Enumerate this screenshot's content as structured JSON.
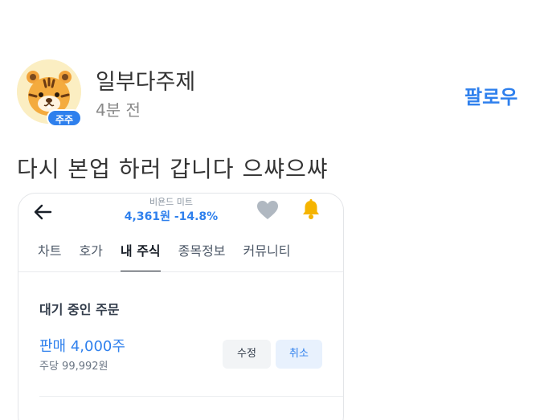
{
  "post": {
    "username": "일부다주제",
    "timestamp": "4분 전",
    "badge": "주주",
    "follow_label": "팔로우",
    "text": "다시 본업 하러 갑니다 으쌰으쌰"
  },
  "stock_app": {
    "stock_name": "비욘드 미트",
    "price_line": "4,361원 -14.8%",
    "tabs": [
      {
        "label": "차트",
        "active": false
      },
      {
        "label": "호가",
        "active": false
      },
      {
        "label": "내 주식",
        "active": true
      },
      {
        "label": "종목정보",
        "active": false
      },
      {
        "label": "커뮤니티",
        "active": false
      }
    ],
    "section_title": "대기 중인 주문",
    "order": {
      "title": "판매 4,000주",
      "subtitle": "주당 99,992원",
      "edit_label": "수정",
      "cancel_label": "취소"
    }
  },
  "colors": {
    "accent": "#2f80ed",
    "bell": "#f5b400",
    "heart": "#b0b8c1"
  },
  "icons": {
    "avatar": "tiger-avatar",
    "back": "arrow-left-icon",
    "heart": "heart-icon",
    "bell": "bell-icon"
  }
}
